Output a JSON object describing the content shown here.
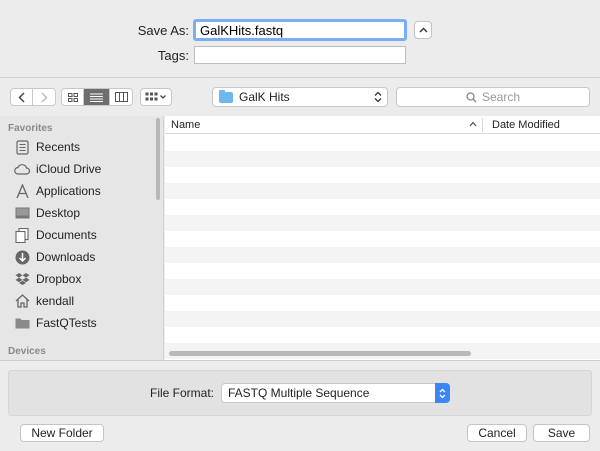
{
  "save_as": {
    "label": "Save As:",
    "value": "GalKHits.fastq"
  },
  "tags": {
    "label": "Tags:",
    "value": ""
  },
  "toolbar": {
    "location": "GalK Hits",
    "search_placeholder": "Search"
  },
  "sidebar": {
    "favorites_heading": "Favorites",
    "items": [
      {
        "label": "Recents",
        "icon": "recents-icon"
      },
      {
        "label": "iCloud Drive",
        "icon": "cloud-icon"
      },
      {
        "label": "Applications",
        "icon": "applications-icon"
      },
      {
        "label": "Desktop",
        "icon": "desktop-icon"
      },
      {
        "label": "Documents",
        "icon": "documents-icon"
      },
      {
        "label": "Downloads",
        "icon": "downloads-icon"
      },
      {
        "label": "Dropbox",
        "icon": "dropbox-icon"
      },
      {
        "label": "kendall",
        "icon": "home-icon"
      },
      {
        "label": "FastQTests",
        "icon": "folder-icon"
      }
    ],
    "devices_heading": "Devices"
  },
  "file_list": {
    "columns": [
      "Name",
      "Date Modified"
    ],
    "rows": []
  },
  "file_format": {
    "label": "File Format:",
    "value": "FASTQ Multiple Sequence"
  },
  "buttons": {
    "new_folder": "New Folder",
    "cancel": "Cancel",
    "save": "Save"
  },
  "colors": {
    "accent": "#3b86f7",
    "focus_ring": "#7aaef4",
    "folder": "#6fb8ee"
  }
}
